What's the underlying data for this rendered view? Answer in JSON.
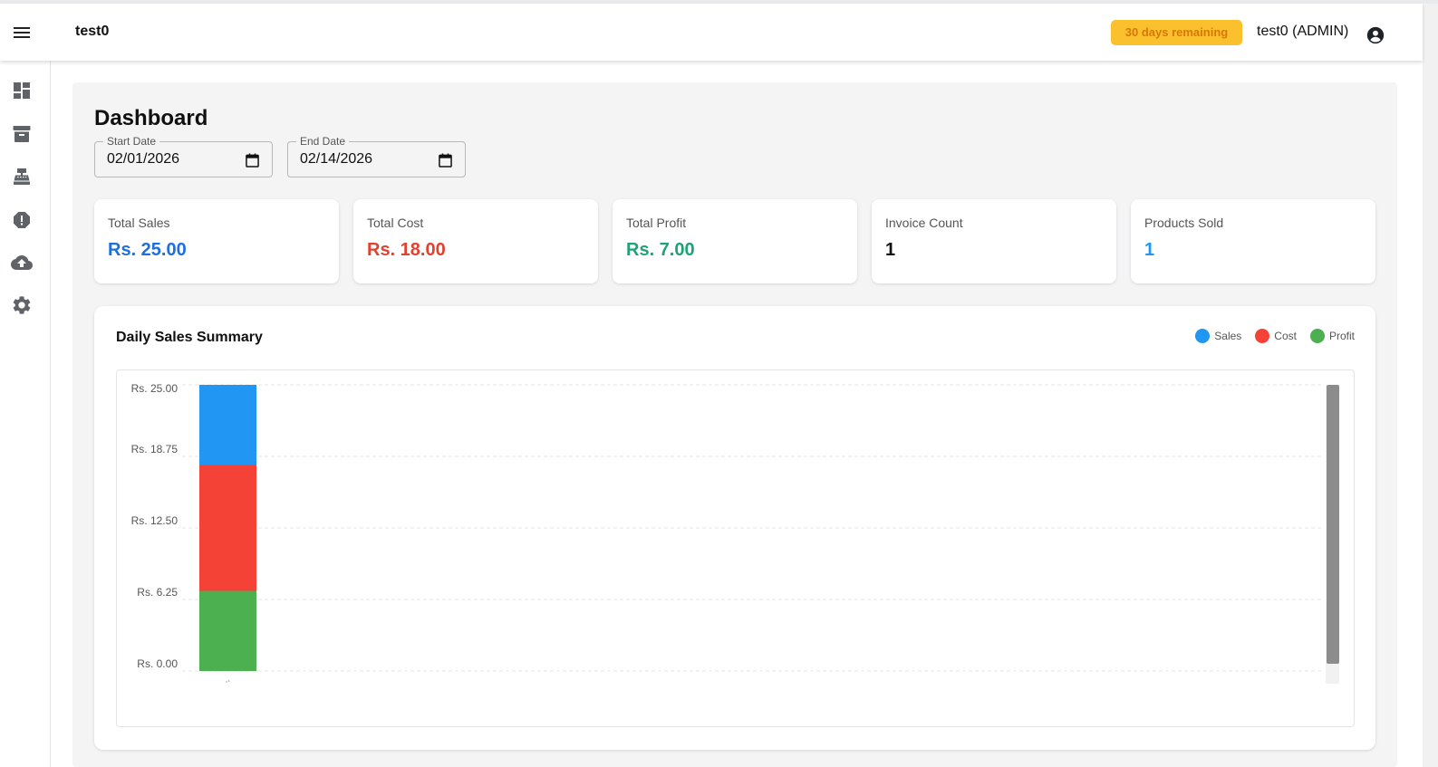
{
  "header": {
    "app_name": "test0",
    "trial_badge": "30 days remaining",
    "user_label": "test0 (ADMIN)"
  },
  "sidebar": {
    "items": [
      {
        "icon": "dashboard-icon"
      },
      {
        "icon": "archive-icon"
      },
      {
        "icon": "cash-register-icon"
      },
      {
        "icon": "alert-icon"
      },
      {
        "icon": "cloud-upload-icon"
      },
      {
        "icon": "settings-gear-icon"
      }
    ]
  },
  "page": {
    "title": "Dashboard"
  },
  "filters": {
    "start_date": {
      "label": "Start Date",
      "value": "02/01/2026"
    },
    "end_date": {
      "label": "End Date",
      "value": "02/14/2026"
    }
  },
  "stats": [
    {
      "label": "Total Sales",
      "value": "Rs. 25.00",
      "color": "#1e6fe0"
    },
    {
      "label": "Total Cost",
      "value": "Rs. 18.00",
      "color": "#e2412f"
    },
    {
      "label": "Total Profit",
      "value": "Rs. 7.00",
      "color": "#1fa277"
    },
    {
      "label": "Invoice Count",
      "value": "1",
      "color": "#111111"
    },
    {
      "label": "Products Sold",
      "value": "1",
      "color": "#2196f3"
    }
  ],
  "chart": {
    "title": "Daily Sales Summary",
    "legend": [
      {
        "label": "Sales",
        "color": "#2196f3"
      },
      {
        "label": "Cost",
        "color": "#f44336"
      },
      {
        "label": "Profit",
        "color": "#4caf50"
      }
    ]
  },
  "chart_data": {
    "type": "bar",
    "stacked": false,
    "overlapping": true,
    "categories": [
      ".."
    ],
    "series": [
      {
        "name": "Sales",
        "values": [
          25
        ],
        "color": "#2196f3"
      },
      {
        "name": "Cost",
        "values": [
          18
        ],
        "color": "#f44336"
      },
      {
        "name": "Profit",
        "values": [
          7
        ],
        "color": "#4caf50"
      }
    ],
    "yticks": [
      "Rs. 0.00",
      "Rs. 6.25",
      "Rs. 12.50",
      "Rs. 18.75",
      "Rs. 25.00"
    ],
    "ylim": [
      0,
      25
    ],
    "grid": true,
    "legend_position": "top-right"
  }
}
